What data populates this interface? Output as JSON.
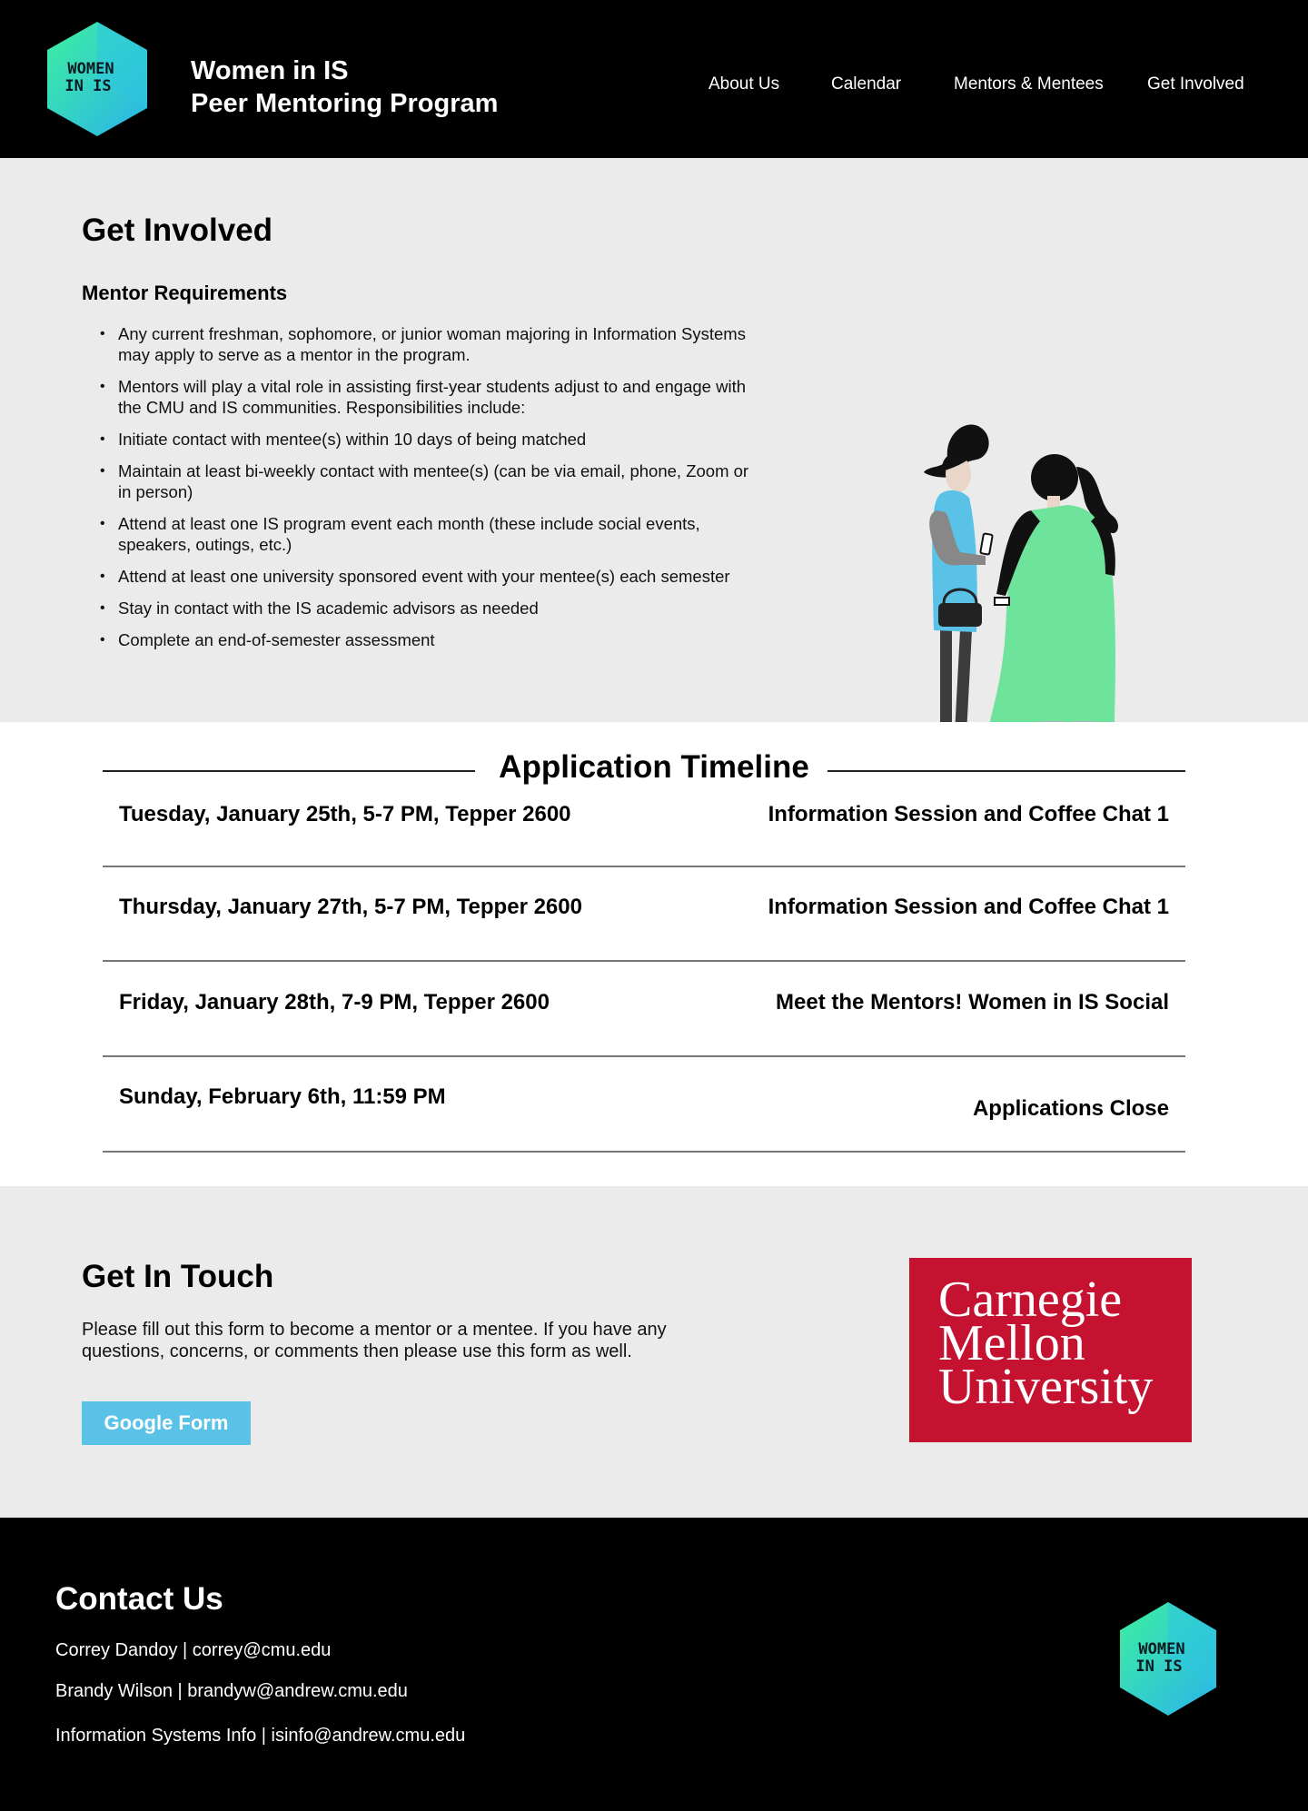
{
  "header": {
    "logo_text": [
      "WOMEN",
      "IN IS"
    ],
    "title_line1": "Women in IS",
    "title_line2": "Peer Mentoring Program",
    "nav": {
      "about": "About Us",
      "calendar": "Calendar",
      "mentors": "Mentors & Mentees",
      "involved": "Get Involved"
    }
  },
  "involved": {
    "title": "Get Involved",
    "subtitle": "Mentor Requirements",
    "requirements": [
      "Any current freshman, sophomore, or junior woman majoring in Information Systems may apply to serve as a mentor in the program.",
      "Mentors will play a vital role in assisting first-year students adjust to and engage with the CMU and IS communities. Responsibilities include:",
      "Initiate contact with mentee(s) within 10 days of being matched",
      "Maintain at least bi-weekly contact with mentee(s) (can be via email, phone, Zoom or in person)",
      "Attend at least one IS program event each month (these include social events, speakers, outings, etc.)",
      "Attend at least one university sponsored event with your mentee(s) each semester",
      "Stay in contact with the IS academic advisors as needed",
      "Complete an end-of-semester assessment"
    ]
  },
  "timeline": {
    "title": "Application Timeline",
    "rows": [
      {
        "date": "Tuesday, January 25th, 5-7 PM, Tepper 2600",
        "event": "Information Session and Coffee Chat 1"
      },
      {
        "date": "Thursday, January 27th, 5-7 PM, Tepper 2600",
        "event": "Information Session and Coffee Chat 1"
      },
      {
        "date": "Friday, January 28th, 7-9 PM, Tepper 2600",
        "event": "Meet the Mentors! Women in IS Social"
      },
      {
        "date": "Sunday, February 6th, 11:59 PM",
        "event": "Applications Close"
      }
    ]
  },
  "touch": {
    "title": "Get In Touch",
    "body": "Please fill out this form to become a mentor or a mentee. If you have any questions, concerns, or comments then please use this form as well.",
    "button": "Google Form",
    "cmu_logo": [
      "Carnegie",
      "Mellon",
      "University"
    ]
  },
  "footer": {
    "title": "Contact Us",
    "contacts": [
      "Correy Dandoy | correy@cmu.edu",
      "Brandy Wilson | brandyw@andrew.cmu.edu",
      "Information Systems Info | isinfo@andrew.cmu.edu"
    ]
  },
  "colors": {
    "accent_blue": "#5bc2e7",
    "cmu_red": "#c41230",
    "illustration_green": "#6ee39b",
    "logo_green": "#2ee6a6",
    "logo_cyan": "#2bb8e8"
  },
  "icons": [
    "women-in-is-logo",
    "mentors-illustration",
    "cmu-logo"
  ]
}
